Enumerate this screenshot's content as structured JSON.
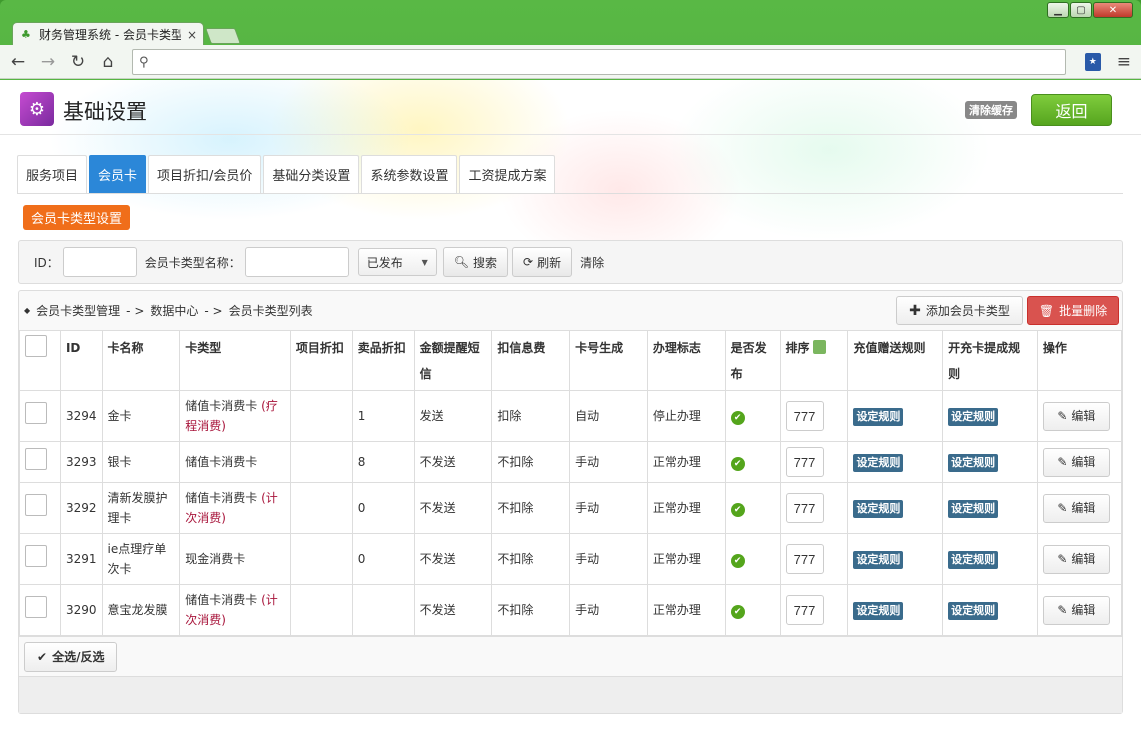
{
  "browser": {
    "tab_title": "财务管理系统 - 会员卡类型",
    "tab_close": "×",
    "url": ""
  },
  "header": {
    "title": "基础设置",
    "clear_cache": "清除缓存",
    "back": "返回"
  },
  "tabs": [
    {
      "label": "服务项目",
      "active": false
    },
    {
      "label": "会员卡",
      "active": true
    },
    {
      "label": "项目折扣/会员价",
      "active": false
    },
    {
      "label": "基础分类设置",
      "active": false
    },
    {
      "label": "系统参数设置",
      "active": false
    },
    {
      "label": "工资提成方案",
      "active": false
    }
  ],
  "section_button": "会员卡类型设置",
  "search": {
    "id_label": "ID：",
    "id_value": "",
    "name_label": "会员卡类型名称：",
    "name_value": "",
    "status_selected": "已发布",
    "search_btn": "搜索",
    "refresh_btn": "刷新",
    "clear": "清除"
  },
  "breadcrumb": {
    "a": "会员卡类型管理",
    "sep1": "- >",
    "b": "数据中心",
    "sep2": "- >",
    "c": "会员卡类型列表"
  },
  "actions": {
    "add": "添加会员卡类型",
    "batch_delete": "批量删除"
  },
  "table": {
    "headers": [
      "",
      "ID",
      "卡名称",
      "卡类型",
      "项目折扣",
      "卖品折扣",
      "金额提醒短信",
      "扣信息费",
      "卡号生成",
      "办理标志",
      "是否发布",
      "排序",
      "充值赠送规则",
      "开充卡提成规则",
      "操作"
    ],
    "rows": [
      {
        "id": "3294",
        "name": "金卡",
        "type": "储值卡消费卡",
        "type_extra": "(疗程消费)",
        "item_discount": "",
        "goods_discount": "1",
        "sms": "发送",
        "fee": "扣除",
        "gen": "自动",
        "flag": "停止办理",
        "sort": "777",
        "rule1": "设定规则",
        "rule2": "设定规则",
        "edit": "编辑"
      },
      {
        "id": "3293",
        "name": "银卡",
        "type": "储值卡消费卡",
        "type_extra": "",
        "item_discount": "",
        "goods_discount": "8",
        "sms": "不发送",
        "fee": "不扣除",
        "gen": "手动",
        "flag": "正常办理",
        "sort": "777",
        "rule1": "设定规则",
        "rule2": "设定规则",
        "edit": "编辑"
      },
      {
        "id": "3292",
        "name": "清新发膜护理卡",
        "type": "储值卡消费卡",
        "type_extra": "(计次消费)",
        "item_discount": "",
        "goods_discount": "0",
        "sms": "不发送",
        "fee": "不扣除",
        "gen": "手动",
        "flag": "正常办理",
        "sort": "777",
        "rule1": "设定规则",
        "rule2": "设定规则",
        "edit": "编辑"
      },
      {
        "id": "3291",
        "name": "ie点理疗单次卡",
        "type": "现金消费卡",
        "type_extra": "",
        "item_discount": "",
        "goods_discount": "0",
        "sms": "不发送",
        "fee": "不扣除",
        "gen": "手动",
        "flag": "正常办理",
        "sort": "777",
        "rule1": "设定规则",
        "rule2": "设定规则",
        "edit": "编辑"
      },
      {
        "id": "3290",
        "name": "意宝龙发膜",
        "type": "储值卡消费卡",
        "type_extra": "(计次消费)",
        "item_discount": "",
        "goods_discount": "",
        "sms": "不发送",
        "fee": "不扣除",
        "gen": "手动",
        "flag": "正常办理",
        "sort": "777",
        "rule1": "设定规则",
        "rule2": "设定规则",
        "edit": "编辑"
      }
    ]
  },
  "select_all": "全选/反选",
  "colors": {
    "tab_active": "#2b87d8",
    "section_btn": "#f06e1a",
    "back_btn": "#56a51f",
    "delete_btn": "#d9534f",
    "rule_badge": "#3a6b8c",
    "type_highlight": "#a8153b",
    "published_icon": "#54a51c"
  },
  "icons": {
    "back": "arrow-left-icon",
    "forward": "arrow-right-icon",
    "reload": "reload-icon",
    "home": "home-icon",
    "search": "search-icon",
    "add": "plus-icon",
    "delete": "trash-icon",
    "refresh": "refresh-icon",
    "edit": "edit-icon",
    "check": "check-icon"
  }
}
